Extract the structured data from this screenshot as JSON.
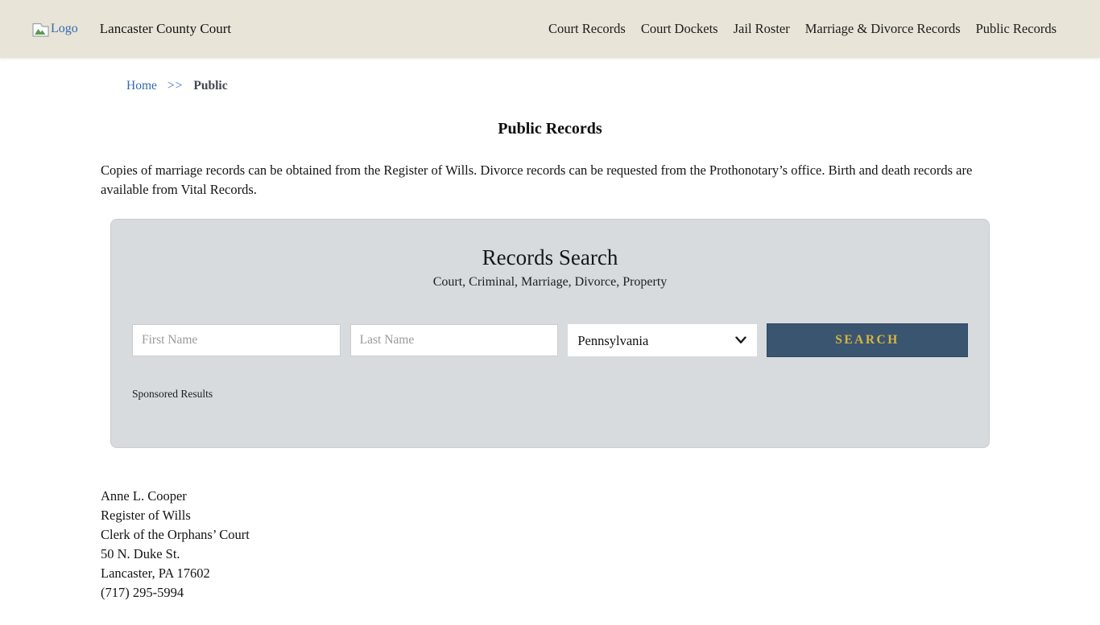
{
  "header": {
    "logo_alt": "Logo",
    "site_title": "Lancaster County Court",
    "nav": [
      {
        "label": "Court Records"
      },
      {
        "label": "Court Dockets"
      },
      {
        "label": "Jail Roster"
      },
      {
        "label": "Marriage & Divorce Records"
      },
      {
        "label": "Public Records"
      }
    ]
  },
  "breadcrumb": {
    "home_label": "Home",
    "separator": ">>",
    "current": "Public"
  },
  "page": {
    "title": "Public Records",
    "intro": "Copies of marriage records can be obtained from the Register of Wills. Divorce records can be requested from the Prothonotary’s office. Birth and death records are available from Vital Records."
  },
  "search_panel": {
    "title": "Records Search",
    "subtitle": "Court, Criminal, Marriage, Divorce, Property",
    "first_name_placeholder": "First Name",
    "last_name_placeholder": "Last Name",
    "state_selected": "Pennsylvania",
    "search_label": "SEARCH",
    "sponsored_label": "Sponsored Results"
  },
  "contact": {
    "lines": [
      "Anne L. Cooper",
      "Register of Wills",
      "Clerk of the Orphans’ Court",
      "50 N. Duke St.",
      "Lancaster, PA 17602",
      "(717) 295-5994"
    ]
  },
  "colors": {
    "header_bg": "#e8e4d7",
    "panel_bg": "#d8dbde",
    "button_bg": "#3a5570",
    "button_text": "#d9b53c",
    "link_blue": "#3468b0"
  }
}
